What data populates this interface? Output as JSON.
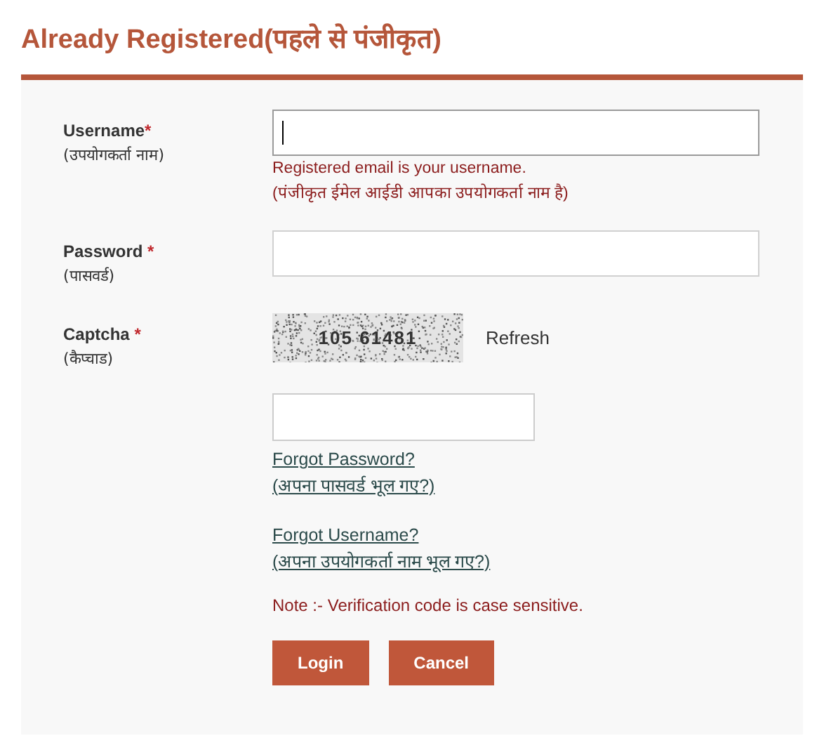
{
  "heading": "Already Registered(पहले से पंजीकृत)",
  "fields": [
    {
      "kind": "input",
      "label": "Username",
      "required_mark": "*",
      "sublabel": "(उपयोगकर्ता नाम)",
      "focused": true,
      "hints": [
        "Registered email is your username.",
        "(पंजीकृत ईमेल आईडी आपका उपयोगकर्ता नाम है)"
      ]
    },
    {
      "kind": "input",
      "label": "Password",
      "required_mark": "*",
      "sublabel": "(पासवर्ड)",
      "focused": false
    },
    {
      "kind": "captcha",
      "label": "Captcha",
      "required_mark": "*",
      "sublabel": "(कैप्चाड)",
      "code": "105 61481",
      "refresh": "Refresh"
    }
  ],
  "links": [
    [
      "Forgot Password?",
      "(अपना पासवर्ड भूल गए?)"
    ],
    [
      "Forgot Username?",
      "(अपना उपयोगकर्ता नाम भूल गए?)"
    ]
  ],
  "note": "Note :- Verification code is case sensitive.",
  "buttons": [
    "Login",
    "Cancel"
  ]
}
